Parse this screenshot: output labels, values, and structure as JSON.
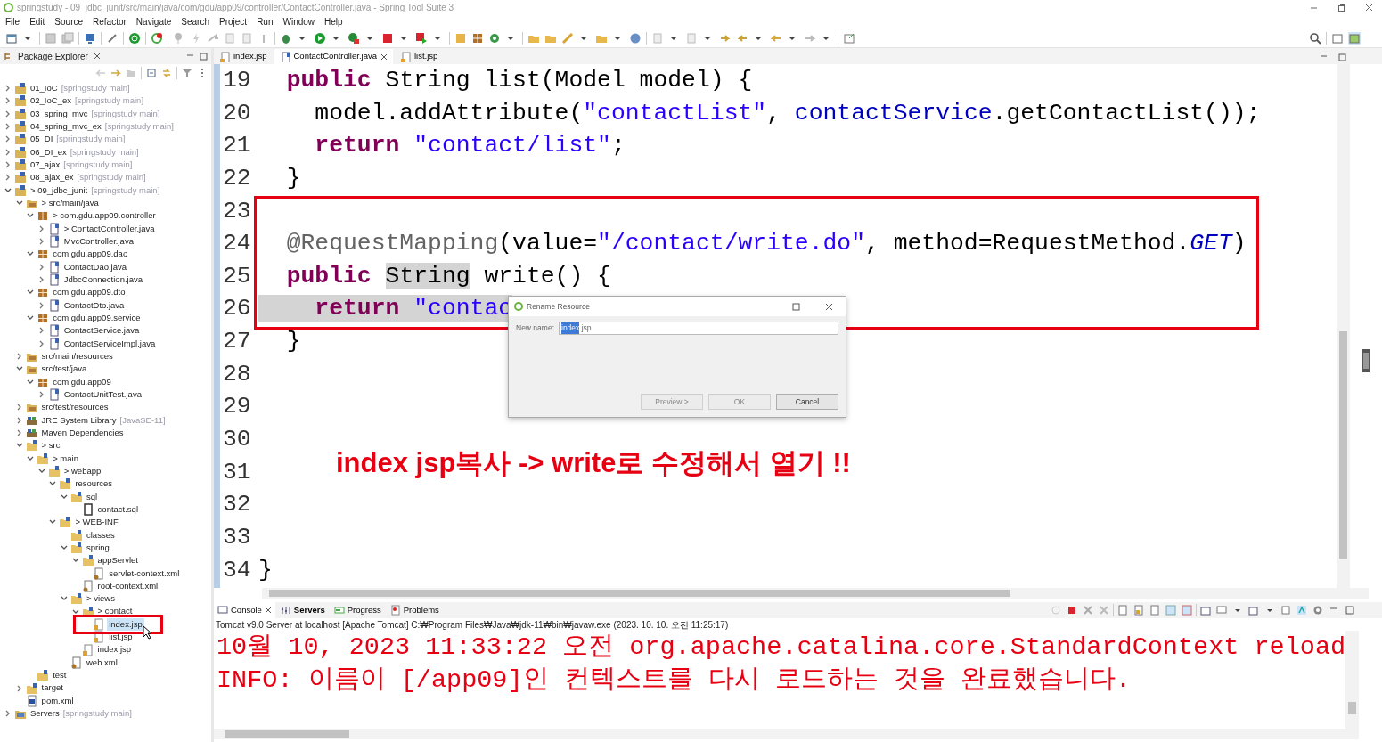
{
  "window": {
    "title": "springstudy - 09_jdbc_junit/src/main/java/com/gdu/app09/controller/ContactController.java - Spring Tool Suite 3"
  },
  "menu": [
    "File",
    "Edit",
    "Source",
    "Refactor",
    "Navigate",
    "Search",
    "Project",
    "Run",
    "Window",
    "Help"
  ],
  "package_explorer": {
    "title": "Package Explorer",
    "tree": [
      {
        "label": "01_IoC",
        "suffix": "[springstudy main]",
        "kind": "project",
        "expanded": false,
        "selected": false
      },
      {
        "label": "02_IoC_ex",
        "suffix": "[springstudy main]",
        "kind": "project",
        "expanded": false,
        "selected": false
      },
      {
        "label": "03_spring_mvc",
        "suffix": "[springstudy main]",
        "kind": "project",
        "expanded": false,
        "selected": false
      },
      {
        "label": "04_spring_mvc_ex",
        "suffix": "[springstudy main]",
        "kind": "project",
        "expanded": false,
        "selected": false
      },
      {
        "label": "05_DI",
        "suffix": "[springstudy main]",
        "kind": "project",
        "expanded": false,
        "selected": false
      },
      {
        "label": "06_DI_ex",
        "suffix": "[springstudy main]",
        "kind": "project",
        "expanded": false,
        "selected": false
      },
      {
        "label": "07_ajax",
        "suffix": "[springstudy main]",
        "kind": "project",
        "expanded": false,
        "selected": false
      },
      {
        "label": "08_ajax_ex",
        "suffix": "[springstudy main]",
        "kind": "project",
        "expanded": false,
        "selected": false
      },
      {
        "label": "> 09_jdbc_junit",
        "suffix": "[springstudy main]",
        "kind": "project",
        "expanded": true,
        "selected": false,
        "children": [
          {
            "label": "> src/main/java",
            "kind": "srcfolder",
            "expanded": true,
            "selected": false,
            "children": [
              {
                "label": "> com.gdu.app09.controller",
                "kind": "package",
                "expanded": true,
                "selected": false,
                "children": [
                  {
                    "label": "> ContactController.java",
                    "kind": "java",
                    "expanded": false,
                    "selected": false
                  },
                  {
                    "label": "MvcController.java",
                    "kind": "java",
                    "expanded": false,
                    "selected": false
                  }
                ]
              },
              {
                "label": "com.gdu.app09.dao",
                "kind": "package",
                "expanded": true,
                "selected": false,
                "children": [
                  {
                    "label": "ContactDao.java",
                    "kind": "java",
                    "expanded": false,
                    "selected": false
                  },
                  {
                    "label": "JdbcConnection.java",
                    "kind": "java",
                    "expanded": false,
                    "selected": false
                  }
                ]
              },
              {
                "label": "com.gdu.app09.dto",
                "kind": "package",
                "expanded": true,
                "selected": false,
                "children": [
                  {
                    "label": "ContactDto.java",
                    "kind": "java",
                    "expanded": false,
                    "selected": false
                  }
                ]
              },
              {
                "label": "com.gdu.app09.service",
                "kind": "package",
                "expanded": true,
                "selected": false,
                "children": [
                  {
                    "label": "ContactService.java",
                    "kind": "java",
                    "expanded": false,
                    "selected": false
                  },
                  {
                    "label": "ContactServiceImpl.java",
                    "kind": "java",
                    "expanded": false,
                    "selected": false
                  }
                ]
              }
            ]
          },
          {
            "label": "src/main/resources",
            "kind": "srcfolder",
            "expanded": false,
            "selected": false
          },
          {
            "label": "src/test/java",
            "kind": "srcfolder",
            "expanded": true,
            "selected": false,
            "children": [
              {
                "label": "com.gdu.app09",
                "kind": "package",
                "expanded": true,
                "selected": false,
                "children": [
                  {
                    "label": "ContactUnitTest.java",
                    "kind": "java",
                    "expanded": false,
                    "selected": false
                  }
                ]
              }
            ]
          },
          {
            "label": "src/test/resources",
            "kind": "srcfolder",
            "expanded": false,
            "selected": false
          },
          {
            "label": "JRE System Library",
            "suffix": "[JavaSE-11]",
            "kind": "library",
            "expanded": false,
            "selected": false
          },
          {
            "label": "Maven Dependencies",
            "kind": "library",
            "expanded": false,
            "selected": false
          },
          {
            "label": "> src",
            "kind": "folder",
            "expanded": true,
            "selected": false,
            "children": [
              {
                "label": "> main",
                "kind": "folder",
                "expanded": true,
                "selected": false,
                "children": [
                  {
                    "label": "> webapp",
                    "kind": "folder",
                    "expanded": true,
                    "selected": false,
                    "children": [
                      {
                        "label": "resources",
                        "kind": "folder",
                        "expanded": true,
                        "selected": false,
                        "children": [
                          {
                            "label": "sql",
                            "kind": "folder",
                            "expanded": true,
                            "selected": false,
                            "children": [
                              {
                                "label": "contact.sql",
                                "kind": "file",
                                "selected": false
                              }
                            ]
                          }
                        ]
                      },
                      {
                        "label": "> WEB-INF",
                        "kind": "folder",
                        "expanded": true,
                        "selected": false,
                        "children": [
                          {
                            "label": "classes",
                            "kind": "folder",
                            "selected": false
                          },
                          {
                            "label": "spring",
                            "kind": "folder",
                            "expanded": true,
                            "selected": false,
                            "children": [
                              {
                                "label": "appServlet",
                                "kind": "folder",
                                "expanded": true,
                                "selected": false,
                                "children": [
                                  {
                                    "label": "servlet-context.xml",
                                    "kind": "xml",
                                    "selected": false
                                  }
                                ]
                              },
                              {
                                "label": "root-context.xml",
                                "kind": "xml",
                                "selected": false
                              }
                            ]
                          },
                          {
                            "label": "> views",
                            "kind": "folder",
                            "expanded": true,
                            "selected": false,
                            "children": [
                              {
                                "label": "> contact",
                                "kind": "folder",
                                "expanded": true,
                                "selected": false,
                                "children": [
                                  {
                                    "label": "index.jsp",
                                    "kind": "jsp",
                                    "selected": true
                                  },
                                  {
                                    "label": "list.jsp",
                                    "kind": "jsp",
                                    "selected": false
                                  }
                                ]
                              },
                              {
                                "label": "index.jsp",
                                "kind": "jsp",
                                "selected": false
                              }
                            ]
                          },
                          {
                            "label": "web.xml",
                            "kind": "xml",
                            "selected": false
                          }
                        ]
                      }
                    ]
                  }
                ]
              },
              {
                "label": "test",
                "kind": "folder",
                "selected": false
              }
            ]
          },
          {
            "label": "target",
            "kind": "folder",
            "expanded": false,
            "selected": false
          },
          {
            "label": "pom.xml",
            "kind": "pom",
            "selected": false
          }
        ]
      },
      {
        "label": "Servers",
        "suffix": "[springstudy main]",
        "kind": "servers",
        "expanded": false,
        "selected": false
      }
    ]
  },
  "editor": {
    "tabs": [
      {
        "label": "index.jsp",
        "kind": "jsp",
        "selected": false,
        "closable": false
      },
      {
        "label": "ContactController.java",
        "kind": "java",
        "selected": true,
        "closable": true
      },
      {
        "label": "list.jsp",
        "kind": "jsp",
        "selected": false,
        "closable": false
      }
    ],
    "lines": [
      {
        "number": "19",
        "boxed": false,
        "segments": [
          {
            "kind": "keyword",
            "text": "  public",
            "highlighted": false
          },
          {
            "kind": "plain",
            "text": " String list(Model model) {",
            "highlighted": false
          }
        ]
      },
      {
        "number": "20",
        "boxed": false,
        "segments": [
          {
            "kind": "plain",
            "text": "    model.addAttribute(",
            "highlighted": false
          },
          {
            "kind": "string",
            "text": "\"contactList\"",
            "highlighted": false
          },
          {
            "kind": "plain",
            "text": ", ",
            "highlighted": false
          },
          {
            "kind": "field",
            "text": "contactService",
            "highlighted": false
          },
          {
            "kind": "plain",
            "text": ".getContactList());",
            "highlighted": false
          }
        ]
      },
      {
        "number": "21",
        "boxed": false,
        "segments": [
          {
            "kind": "keyword",
            "text": "    return",
            "highlighted": false
          },
          {
            "kind": "string",
            "text": " \"contact/list\"",
            "highlighted": false
          },
          {
            "kind": "plain",
            "text": ";",
            "highlighted": false
          }
        ]
      },
      {
        "number": "22",
        "boxed": false,
        "segments": [
          {
            "kind": "plain",
            "text": "  }",
            "highlighted": false
          }
        ]
      },
      {
        "number": "23",
        "boxed": true
      },
      {
        "number": "24",
        "boxed": true,
        "segments": [
          {
            "kind": "annotation",
            "text": "  @RequestMapping",
            "highlighted": false
          },
          {
            "kind": "plain",
            "text": "(value=",
            "highlighted": false
          },
          {
            "kind": "string",
            "text": "\"/contact/write.do\"",
            "highlighted": false
          },
          {
            "kind": "plain",
            "text": ", method=RequestMethod.",
            "highlighted": false
          },
          {
            "kind": "constant",
            "text": "GET",
            "highlighted": false
          },
          {
            "kind": "plain",
            "text": ")",
            "highlighted": false
          }
        ]
      },
      {
        "number": "25",
        "boxed": true,
        "segments": [
          {
            "kind": "keyword",
            "text": "  public ",
            "highlighted": false
          },
          {
            "kind": "plain",
            "text": "String",
            "highlighted": true
          },
          {
            "kind": "plain",
            "text": " write() {",
            "highlighted": false
          }
        ]
      },
      {
        "number": "26",
        "boxed": true,
        "segments": [
          {
            "kind": "keyword",
            "text": "    return",
            "highlighted": true
          },
          {
            "kind": "string",
            "text": " \"contac",
            "highlighted": true
          }
        ]
      },
      {
        "number": "27",
        "boxed": false,
        "segments": [
          {
            "kind": "plain",
            "text": "  }",
            "highlighted": false
          }
        ]
      },
      {
        "number": "28",
        "boxed": false
      },
      {
        "number": "29",
        "boxed": false
      },
      {
        "number": "30",
        "boxed": false
      },
      {
        "number": "31",
        "boxed": false
      },
      {
        "number": "32",
        "boxed": false
      },
      {
        "number": "33",
        "boxed": false
      },
      {
        "number": "34",
        "boxed": false,
        "segments": [
          {
            "kind": "plain",
            "text": "}",
            "highlighted": false
          }
        ]
      }
    ]
  },
  "note": "index jsp복사 -> write로 수정해서 열기 !!",
  "dialog": {
    "title": "Rename Resource",
    "field_label": "New name:",
    "value_selected": "index",
    "value_rest": ".jsp",
    "buttons": [
      {
        "label": "Preview >",
        "disabled": true
      },
      {
        "label": "OK",
        "disabled": true
      },
      {
        "label": "Cancel",
        "disabled": false
      }
    ]
  },
  "console": {
    "tabs": [
      {
        "label": "Console",
        "selected": true,
        "bold": false,
        "closable": true,
        "kind": "console"
      },
      {
        "label": "Servers",
        "selected": false,
        "bold": true,
        "closable": false,
        "kind": "servers"
      },
      {
        "label": "Progress",
        "selected": false,
        "bold": false,
        "closable": false,
        "kind": "progress"
      },
      {
        "label": "Problems",
        "selected": false,
        "bold": false,
        "closable": false,
        "kind": "problems"
      }
    ],
    "description": "Tomcat v9.0 Server at localhost [Apache Tomcat] C:₩Program Files₩Java₩jdk-11₩bin₩javaw.exe  (2023. 10. 10. 오전 11:25:17)",
    "output": [
      "10월 10, 2023 11:33:22 오전 org.apache.catalina.core.StandardContext reload",
      "INFO: 이름이 [/app09]인 컨텍스트를 다시 로드하는 것을 완료했습니다."
    ]
  }
}
